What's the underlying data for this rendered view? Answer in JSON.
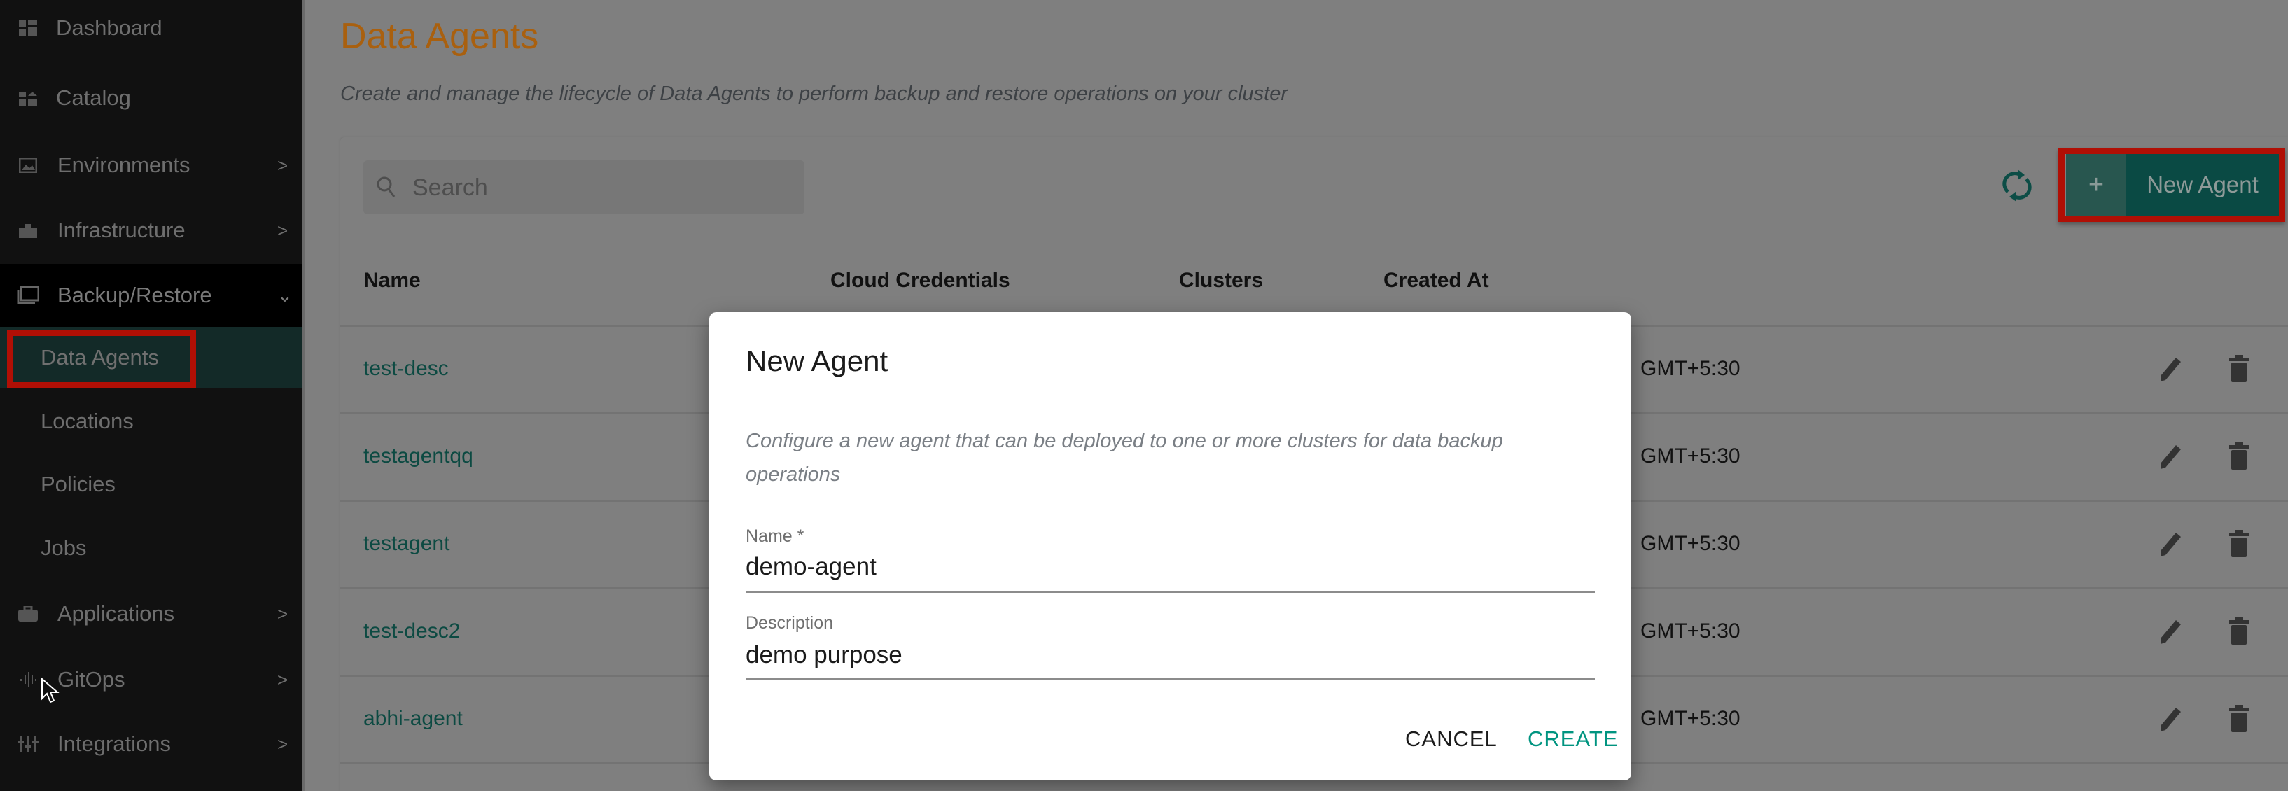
{
  "sidebar": {
    "items": [
      {
        "label": "Dashboard",
        "icon": "dashboard-icon"
      },
      {
        "label": "Catalog",
        "icon": "catalog-icon"
      },
      {
        "label": "Environments",
        "icon": "image-icon",
        "chevron": ">"
      },
      {
        "label": "Infrastructure",
        "icon": "building-icon",
        "chevron": ">"
      },
      {
        "label": "Backup/Restore",
        "icon": "library-icon",
        "chevron": "⌄"
      },
      {
        "label": "Applications",
        "icon": "briefcase-icon",
        "chevron": ">"
      },
      {
        "label": "GitOps",
        "icon": "waveform-icon",
        "chevron": ">"
      },
      {
        "label": "Integrations",
        "icon": "tune-icon",
        "chevron": ">"
      }
    ],
    "subitems": [
      {
        "label": "Data Agents",
        "active": true
      },
      {
        "label": "Locations"
      },
      {
        "label": "Policies"
      },
      {
        "label": "Jobs"
      }
    ]
  },
  "page": {
    "title": "Data Agents",
    "subtitle": "Create and manage the lifecycle of Data Agents to perform backup and restore operations on your cluster",
    "title_color": "#a9600f"
  },
  "toolbar": {
    "search_placeholder": "Search",
    "new_plus": "+",
    "new_label": "New Agent"
  },
  "table": {
    "headers": [
      "Name",
      "Cloud Credentials",
      "Clusters",
      "Created At"
    ],
    "rows": [
      {
        "name": "test-desc",
        "created": "GMT+5:30"
      },
      {
        "name": "testagentqq",
        "created": "GMT+5:30"
      },
      {
        "name": "testagent",
        "created": "GMT+5:30"
      },
      {
        "name": "test-desc2",
        "created": "GMT+5:30"
      },
      {
        "name": "abhi-agent",
        "created": "GMT+5:30"
      }
    ]
  },
  "dialog": {
    "title": "New Agent",
    "description": "Configure a new agent that can be deployed to one or more clusters for data backup operations",
    "name_label": "Name *",
    "name_value": "demo-agent",
    "desc_label": "Description",
    "desc_value": "demo purpose",
    "cancel": "CANCEL",
    "create": "CREATE",
    "accent": "#009480"
  }
}
